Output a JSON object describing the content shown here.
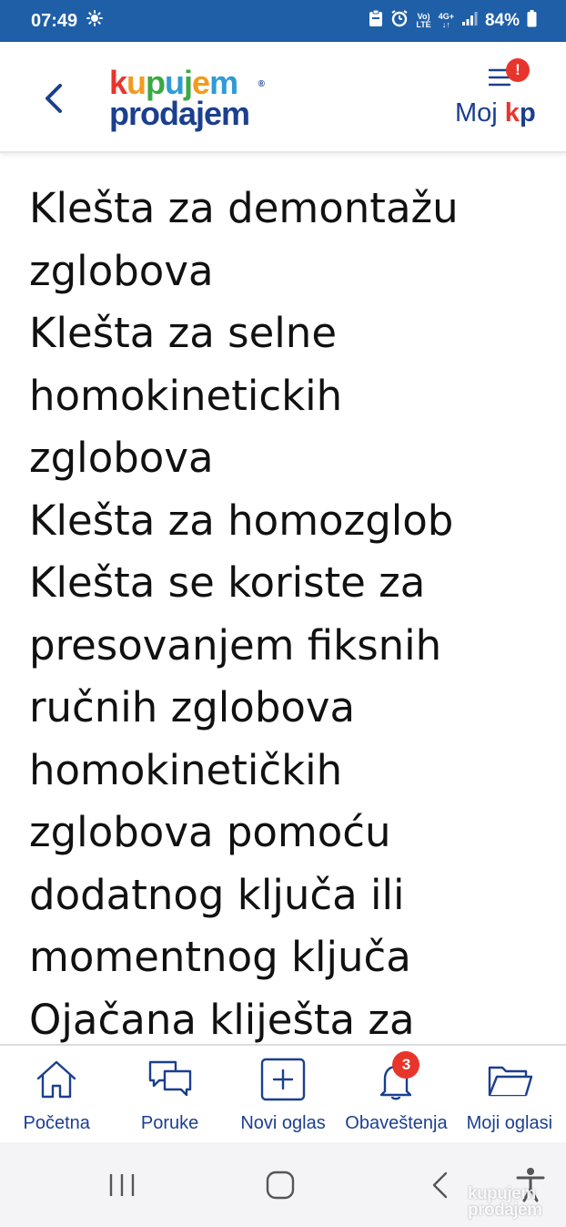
{
  "status_bar": {
    "time": "07:49",
    "network_top": "Vo)",
    "network_bottom": "LTE",
    "signal_type": "4G+",
    "battery": "84%"
  },
  "header": {
    "logo_line1": "kupujem",
    "logo_line2": "prodajem",
    "logo_reg": "®",
    "alert_badge": "!",
    "moj_label": "Moj",
    "kp_k": "k",
    "kp_p": "p"
  },
  "content": {
    "lines": [
      "Klešta za demontažu",
      "zglobova",
      "Klešta za selne",
      "homokinetickih",
      "zglobova",
      "Klešta za homozglob",
      "Klešta se koriste za",
      "presovanjem fiksnih",
      "ručnih zglobova",
      "homokinetičkih",
      "zglobova pomoću",
      "dodatnog ključa ili",
      "momentnog ključa",
      "Ojačana kliješta za"
    ]
  },
  "bottom_nav": {
    "items": [
      {
        "label": "Početna",
        "icon": "home-icon"
      },
      {
        "label": "Poruke",
        "icon": "messages-icon"
      },
      {
        "label": "Novi oglas",
        "icon": "add-ad-icon"
      },
      {
        "label": "Obaveštenja",
        "icon": "bell-icon",
        "badge": "3"
      },
      {
        "label": "Moji oglasi",
        "icon": "folder-icon"
      }
    ]
  },
  "watermark": {
    "line1": "kupujem",
    "line2": "prodajem"
  },
  "colors": {
    "status_bar": "#1e5fa8",
    "brand_blue": "#1b3f8f",
    "brand_red": "#e8352c"
  }
}
